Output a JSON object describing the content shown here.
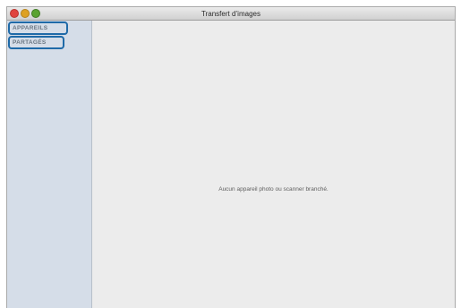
{
  "window": {
    "title": "Transfert d’images"
  },
  "sidebar": {
    "sections": [
      {
        "label": "APPAREILS"
      },
      {
        "label": "PARTAGÉS"
      }
    ]
  },
  "content": {
    "empty_message": "Aucun appareil photo ou scanner branché."
  },
  "colors": {
    "sidebar_bg": "#d5dde8",
    "highlight": "#1f6aa8",
    "close": "#e0443e",
    "minimize": "#dea123",
    "zoom": "#5aa332"
  }
}
